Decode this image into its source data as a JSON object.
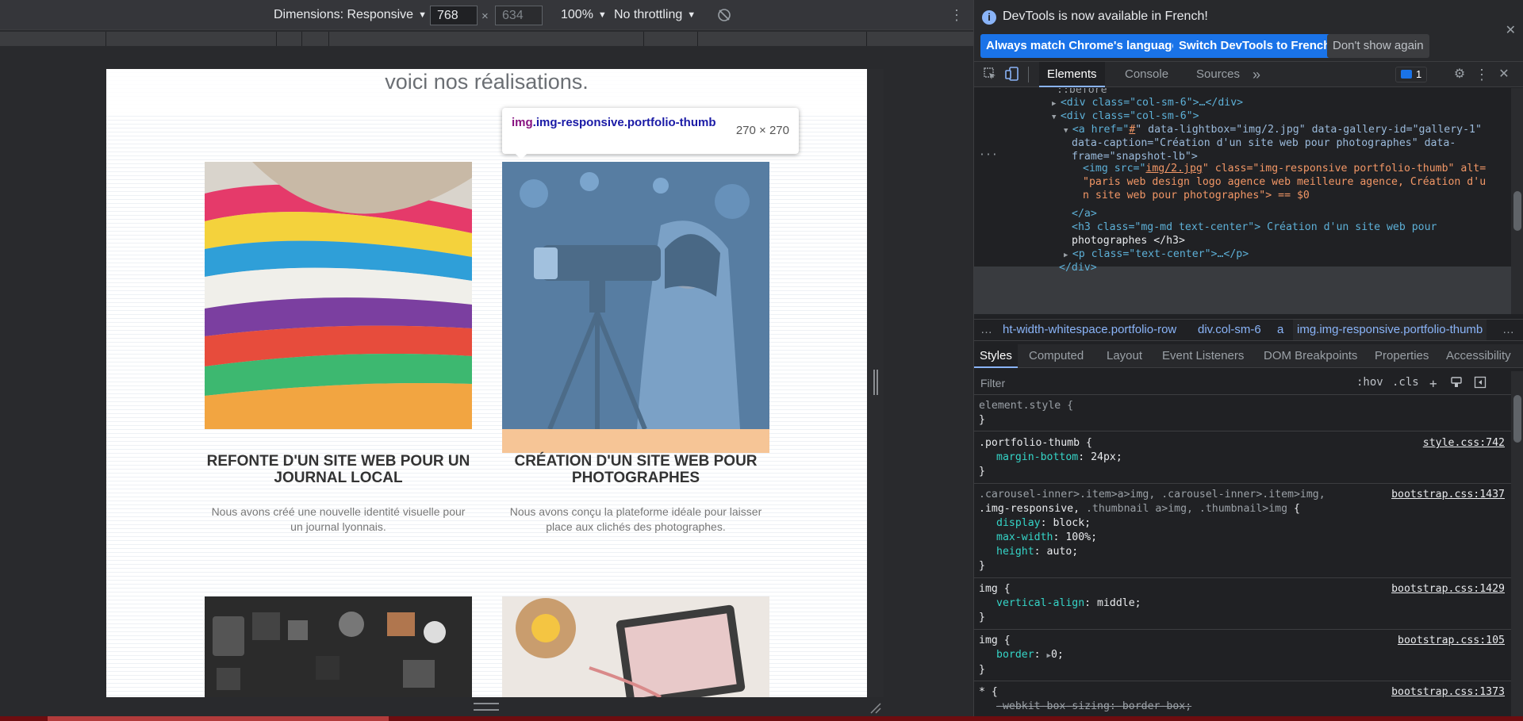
{
  "emulation": {
    "dimensions_label": "Dimensions: Responsive",
    "width_value": "768",
    "height_value": "634",
    "times_symbol": "×",
    "zoom": "100%",
    "throttling": "No throttling",
    "more_icon": "more-vertical-icon",
    "rotate_icon": "rotate-disabled-icon"
  },
  "page": {
    "heading": "voici nos réalisations.",
    "cards": [
      {
        "title": "REFONTE D'UN SITE WEB POUR UN JOURNAL LOCAL",
        "text": "Nous avons créé une nouvelle identité visuelle pour un journal lyonnais."
      },
      {
        "title": "CRÉATION D'UN SITE WEB POUR PHOTOGRAPHES",
        "text": "Nous avons conçu la plateforme idéale pour laisser place aux clichés des photographes."
      }
    ]
  },
  "tooltip": {
    "tag": "img",
    "classes": ".img-responsive.portfolio-thumb",
    "size": "270 × 270"
  },
  "devtools": {
    "infobar": {
      "message": "DevTools is now available in French!",
      "btn_match": "Always match Chrome's language",
      "btn_switch": "Switch DevTools to French",
      "btn_dismiss": "Don't show again"
    },
    "tabs": [
      "Elements",
      "Console",
      "Sources"
    ],
    "issues_count": "1",
    "dom": {
      "before": "::before",
      "line_col1": "<div class=\"col-sm-6\">…</div>",
      "line_col2_open": "<div class=\"col-sm-6\">",
      "a_line1_pre": "<a href=\"",
      "a_href": "#",
      "a_line1_post": "\" data-lightbox=\"img/2.jpg\" data-gallery-id=\"gallery-1\"",
      "a_line2": "data-caption=\"Création d'un site web pour photographes\" data-",
      "a_line3": "frame=\"snapshot-lb\">",
      "img_line1_pre": "<img src=\"",
      "img_src": "img/2.jpg",
      "img_line1_post": "\" class=\"img-responsive portfolio-thumb\" alt=",
      "img_line2": "\"paris web design logo agence web meilleure agence, Création d'u",
      "img_line3": "n site web pour photographes\"> == $0",
      "a_close": "</a>",
      "h3_line1": "<h3 class=\"mg-md text-center\"> Création d'un site web pour",
      "h3_line2": "photographes </h3>",
      "p_line": "<p class=\"text-center\">…</p>",
      "div_close": "</div>"
    },
    "breadcrumbs": [
      "ht-width-whitespace.portfolio-row",
      "div.col-sm-6",
      "a",
      "img.img-responsive.portfolio-thumb"
    ],
    "style_tabs": [
      "Styles",
      "Computed",
      "Layout",
      "Event Listeners",
      "DOM Breakpoints",
      "Properties",
      "Accessibility"
    ],
    "filter_placeholder": "Filter",
    "hov": ":hov",
    "cls": ".cls",
    "rules": [
      {
        "selector": "element.style {",
        "source": "",
        "props": [],
        "close": "}"
      },
      {
        "selector": ".portfolio-thumb {",
        "source": "style.css:742",
        "props": [
          {
            "name": "margin-bottom",
            "value": "24px;"
          }
        ],
        "close": "}"
      },
      {
        "selector_dim": ".carousel-inner>.item>a>img, .carousel-inner>.item>img,",
        "selector": ".img-responsive, ",
        "selector_dim2": ".thumbnail a>img, .thumbnail>img",
        "selector_end": " {",
        "source": "bootstrap.css:1437",
        "props": [
          {
            "name": "display",
            "value": "block;"
          },
          {
            "name": "max-width",
            "value": "100%;"
          },
          {
            "name": "height",
            "value": "auto;"
          }
        ],
        "close": "}"
      },
      {
        "selector": "img {",
        "source": "bootstrap.css:1429",
        "props": [
          {
            "name": "vertical-align",
            "value": "middle;"
          }
        ],
        "close": "}"
      },
      {
        "selector": "img {",
        "source": "bootstrap.css:105",
        "props": [
          {
            "name": "border",
            "value": "0;"
          }
        ],
        "close": "}"
      },
      {
        "selector": "* {",
        "source": "bootstrap.css:1373",
        "props": [
          {
            "name": "-webkit-box-sizing",
            "value": "border-box;"
          }
        ],
        "close": ""
      }
    ]
  }
}
